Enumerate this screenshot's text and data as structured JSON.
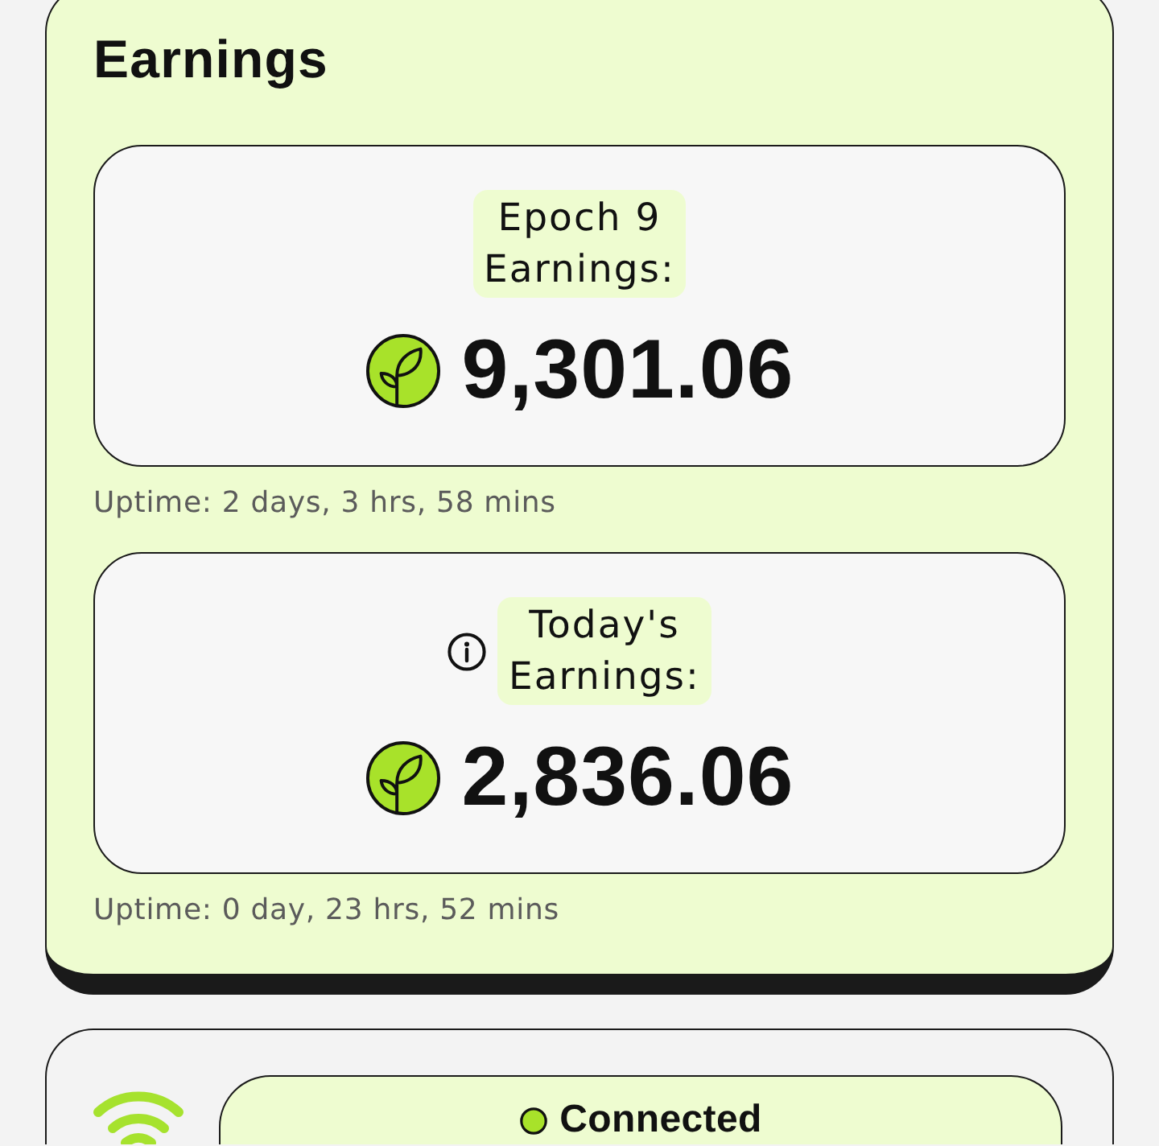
{
  "earnings": {
    "title": "Earnings",
    "cards": [
      {
        "label": "Epoch 9 Earnings:",
        "info_icon": false,
        "amount": "9,301.06",
        "uptime": "Uptime: 2 days, 3 hrs, 58 mins"
      },
      {
        "label": "Today's Earnings:",
        "info_icon": true,
        "amount": "2,836.06",
        "uptime": "Uptime: 0 day, 23 hrs, 52 mins"
      }
    ]
  },
  "connection": {
    "status": "Connected",
    "connected": true
  }
}
